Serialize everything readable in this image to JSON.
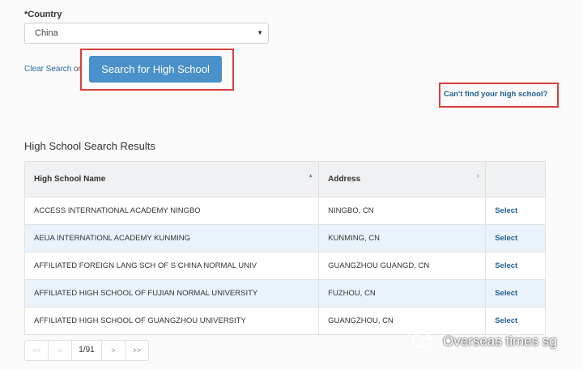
{
  "country": {
    "label": "*Country",
    "selected": "China"
  },
  "actions": {
    "clear_search": "Clear Search",
    "or": "or",
    "search_button": "Search for High School",
    "cant_find": "Can't find your high school?"
  },
  "results": {
    "heading": "High School Search Results",
    "columns": {
      "name": "High School Name",
      "address": "Address"
    },
    "rows": [
      {
        "name": "ACCESS INTERNATIONAL ACADEMY NINGBO",
        "address": "NINGBO, CN",
        "action": "Select"
      },
      {
        "name": "AEUA INTERNATIONL ACADEMY KUNMING",
        "address": "KUNMING, CN",
        "action": "Select"
      },
      {
        "name": "AFFILIATED FOREIGN LANG SCH OF S CHINA NORMAL UNIV",
        "address": "GUANGZHOU GUANGD, CN",
        "action": "Select"
      },
      {
        "name": "AFFILIATED HIGH SCHOOL OF FUJIAN NORMAL UNIVERSITY",
        "address": "FUZHOU, CN",
        "action": "Select"
      },
      {
        "name": "AFFILIATED HIGH SCHOOL OF GUANGZHOU UNIVERSITY",
        "address": "GUANGZHOU, CN",
        "action": "Select"
      }
    ]
  },
  "pager": {
    "first": "<<",
    "prev": "<",
    "page": "1/91",
    "next": ">",
    "last": ">>"
  },
  "watermark": {
    "text": "Overseas times sg"
  },
  "colors": {
    "button_blue": "#4a90c9",
    "link_blue": "#1f5f92",
    "highlight_red": "#d9403a",
    "row_alt": "#eaf2fb"
  }
}
